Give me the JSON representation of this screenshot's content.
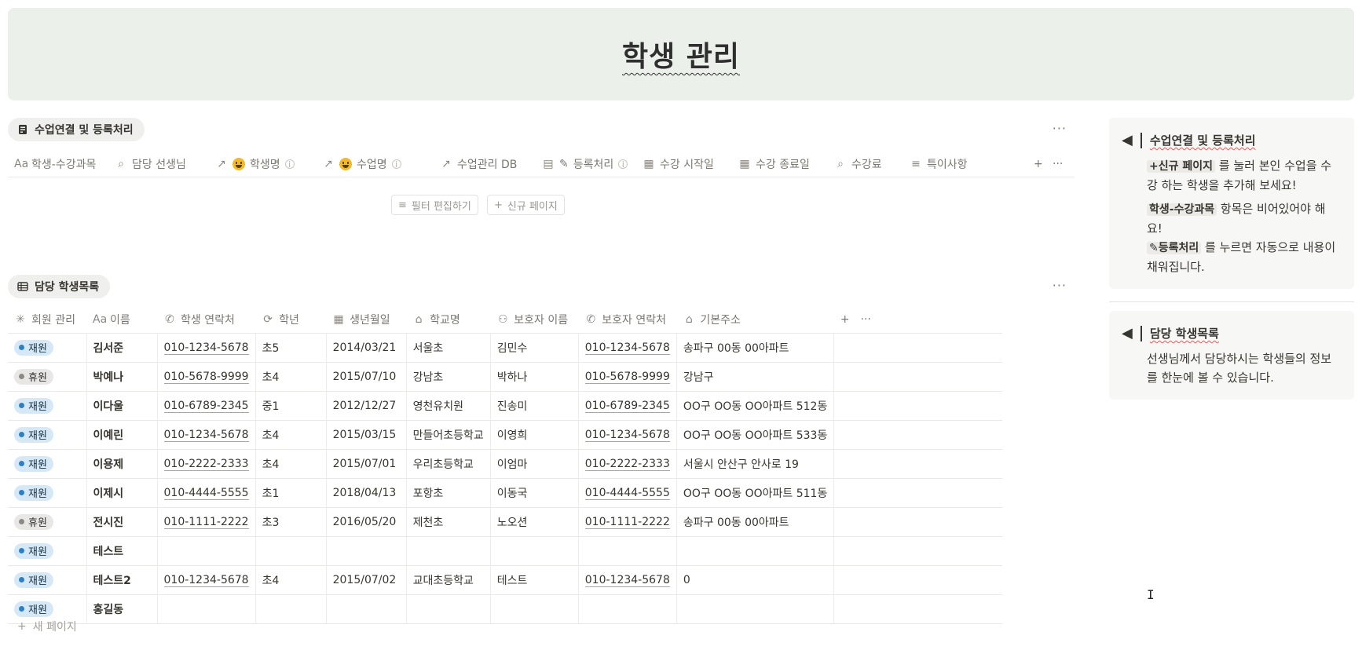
{
  "page": {
    "title": "학생 관리"
  },
  "section1": {
    "tab_label": "수업연결 및 등록처리",
    "more": "···",
    "columns": [
      {
        "icon": "Aa",
        "label": "학생-수강과목"
      },
      {
        "icon": "⌕",
        "label": "담당 선생님"
      },
      {
        "icon": "↗",
        "label": "학생명"
      },
      {
        "icon": "↗",
        "label": "수업명"
      },
      {
        "icon": "↗",
        "label": "수업관리 DB"
      },
      {
        "icon": "▤",
        "label": "등록처리"
      },
      {
        "icon": "▦",
        "label": "수강 시작일"
      },
      {
        "icon": "▦",
        "label": "수강 종료일"
      },
      {
        "icon": "⌕",
        "label": "수강료"
      },
      {
        "icon": "≡",
        "label": "특이사항"
      }
    ],
    "add_col": "+",
    "col_more": "···",
    "filter_btn": "필터 편집하기",
    "new_page_btn": "신규 페이지"
  },
  "section2": {
    "tab_label": "담당 학생목록",
    "more": "···",
    "columns": [
      {
        "icon": "✳",
        "label": "회원 관리"
      },
      {
        "icon": "Aa",
        "label": "이름"
      },
      {
        "icon": "✆",
        "label": "학생 연락처"
      },
      {
        "icon": "⟳",
        "label": "학년"
      },
      {
        "icon": "▦",
        "label": "생년월일"
      },
      {
        "icon": "⌂",
        "label": "학교명"
      },
      {
        "icon": "⚇",
        "label": "보호자 이름"
      },
      {
        "icon": "✆",
        "label": "보호자 연락처"
      },
      {
        "icon": "⌂",
        "label": "기본주소"
      }
    ],
    "add_col": "+",
    "col_more": "···",
    "rows": [
      {
        "status": "재원",
        "status_color": "blue",
        "name": "김서준",
        "phone": "010-1234-5678",
        "grade": "초5",
        "birth": "2014/03/21",
        "school": "서울초",
        "guardian": "김민수",
        "gphone": "010-1234-5678",
        "addr": "송파구 00동 00아파트"
      },
      {
        "status": "휴원",
        "status_color": "gray",
        "name": "박예나",
        "phone": "010-5678-9999",
        "grade": "초4",
        "birth": "2015/07/10",
        "school": "강남초",
        "guardian": "박하나",
        "gphone": "010-5678-9999",
        "addr": "강남구"
      },
      {
        "status": "재원",
        "status_color": "blue",
        "name": "이다울",
        "phone": "010-6789-2345",
        "grade": "중1",
        "birth": "2012/12/27",
        "school": "영천유치원",
        "guardian": "진송미",
        "gphone": "010-6789-2345",
        "addr": "OO구 OO동 OO아파트 512동"
      },
      {
        "status": "재원",
        "status_color": "blue",
        "name": "이예린",
        "phone": "010-1234-5678",
        "grade": "초4",
        "birth": "2015/03/15",
        "school": "만들어초등학교",
        "guardian": "이영희",
        "gphone": "010-1234-5678",
        "addr": "OO구 OO동 OO아파트 533동"
      },
      {
        "status": "재원",
        "status_color": "blue",
        "name": "이용제",
        "phone": "010-2222-2333",
        "grade": "초4",
        "birth": "2015/07/01",
        "school": "우리초등학교",
        "guardian": "이엄마",
        "gphone": "010-2222-2333",
        "addr": "서울시 안산구 안사로 19"
      },
      {
        "status": "재원",
        "status_color": "blue",
        "name": "이제시",
        "phone": "010-4444-5555",
        "grade": "초1",
        "birth": "2018/04/13",
        "school": "포항초",
        "guardian": "이동국",
        "gphone": "010-4444-5555",
        "addr": "OO구 OO동 OO아파트 511동"
      },
      {
        "status": "휴원",
        "status_color": "gray",
        "name": "전시진",
        "phone": "010-1111-2222",
        "grade": "초3",
        "birth": "2016/05/20",
        "school": "제천초",
        "guardian": "노오션",
        "gphone": "010-1111-2222",
        "addr": "송파구 00동 00아파트"
      },
      {
        "status": "재원",
        "status_color": "blue",
        "name": "테스트",
        "phone": "",
        "grade": "",
        "birth": "",
        "school": "",
        "guardian": "",
        "gphone": "",
        "addr": ""
      },
      {
        "status": "재원",
        "status_color": "blue",
        "name": "테스트2",
        "phone": "010-1234-5678",
        "grade": "초4",
        "birth": "2015/07/02",
        "school": "교대초등학교",
        "guardian": "테스트",
        "gphone": "010-1234-5678",
        "addr": "0"
      },
      {
        "status": "재원",
        "status_color": "blue",
        "name": "홍길동",
        "phone": "",
        "grade": "",
        "birth": "",
        "school": "",
        "guardian": "",
        "gphone": "",
        "addr": ""
      }
    ],
    "new_page": "새 페이지"
  },
  "callout1": {
    "title": "수업연결 및 등록처리",
    "code1": "+신규 페이지",
    "text1": " 를 눌러 본인 수업을 수강 하는 학생을 추가해 보세요!",
    "code2": "학생-수강과목",
    "text2": " 항목은 비어있어야 해요!",
    "code3": "등록처리",
    "text3": " 를 누르면 자동으로 내용이 채워집니다."
  },
  "callout2": {
    "title": "담당 학생목록",
    "text": "선생님께서 담당하시는 학생들의 정보를 한눈에 볼 수 있습니다."
  },
  "colors": {
    "banner_bg": "#ebf0ea",
    "badge_blue": "#d6e8f5",
    "badge_gray": "#e8e7e5"
  }
}
